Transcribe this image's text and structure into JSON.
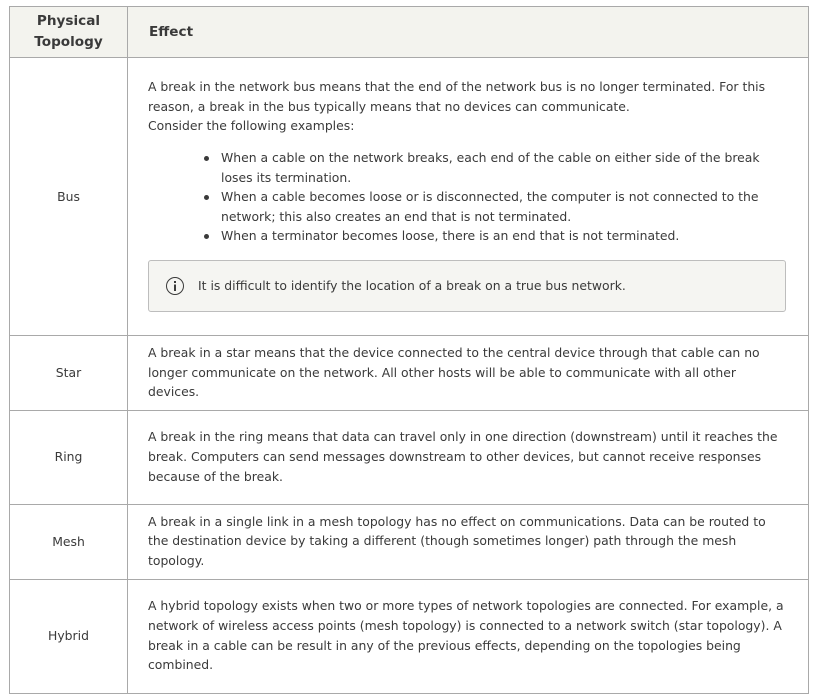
{
  "table": {
    "headers": {
      "topology": "Physical Topology",
      "effect": "Effect"
    },
    "rows": [
      {
        "name": "Bus",
        "paragraphs": [
          "A break in the network bus means that the end of the network bus is no longer terminated. For this reason, a break in the bus typically means that no devices can communicate.",
          "Consider the following examples:"
        ],
        "bullets": [
          "When a cable on the network breaks, each end of the cable on either side of the break loses its termination.",
          "When a cable becomes loose or is disconnected, the computer is not connected to the network; this also creates an end that is not terminated.",
          "When a terminator becomes loose, there is an end that is not terminated."
        ],
        "note": {
          "icon": "info-icon",
          "text": "It is difficult to identify the location of a break on a true bus network."
        }
      },
      {
        "name": "Star",
        "paragraphs": [
          "A break in a star means that the device connected to the central device through that cable can no longer communicate on the network. All other hosts will be able to communicate with all other devices."
        ]
      },
      {
        "name": "Ring",
        "paragraphs": [
          "A break in the ring means that data can travel only in one direction (downstream) until it reaches the break. Computers can send messages downstream to other devices, but cannot receive responses because of the break."
        ]
      },
      {
        "name": "Mesh",
        "paragraphs": [
          "A break in a single link in a mesh topology has no effect on communications. Data can be routed to the destination device by taking a different (though sometimes longer) path through the mesh topology."
        ]
      },
      {
        "name": "Hybrid",
        "paragraphs": [
          "A hybrid topology exists when two or more types of network topologies are connected. For example, a network of wireless access points (mesh topology) is connected to a network switch (star topology). A break in a cable can be result in any of the previous effects, depending on the topologies being combined."
        ]
      }
    ]
  }
}
